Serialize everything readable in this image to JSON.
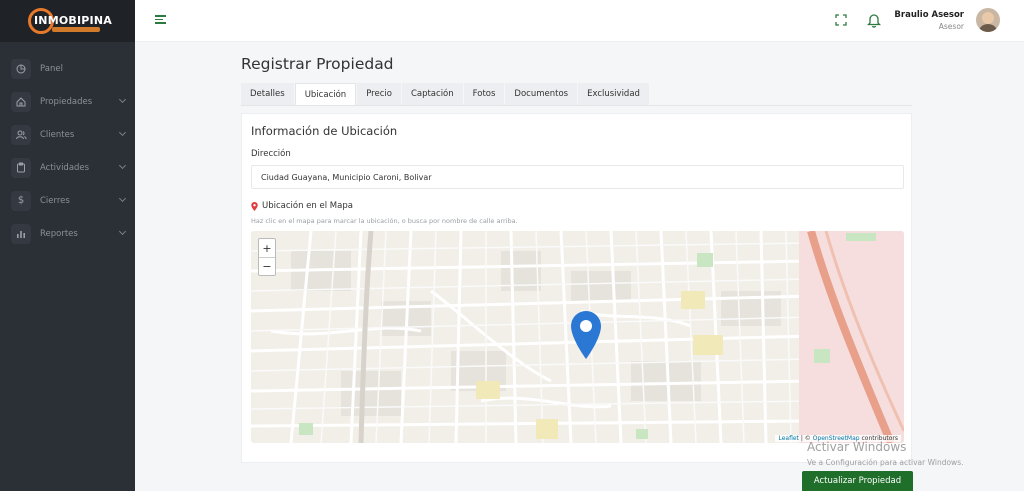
{
  "logo": {
    "text": "INMOBIPINA",
    "brand_color": "#e8782a"
  },
  "sidebar": {
    "items": [
      {
        "label": "Panel",
        "icon": "chart-pie-icon",
        "has_chevron": false
      },
      {
        "label": "Propiedades",
        "icon": "home-icon",
        "has_chevron": true
      },
      {
        "label": "Clientes",
        "icon": "users-icon",
        "has_chevron": true
      },
      {
        "label": "Actividades",
        "icon": "clipboard-icon",
        "has_chevron": true
      },
      {
        "label": "Cierres",
        "icon": "dollar-icon",
        "has_chevron": true
      },
      {
        "label": "Reportes",
        "icon": "bar-chart-icon",
        "has_chevron": true
      }
    ]
  },
  "header": {
    "menu_icon": "hamburger-icon",
    "fullscreen_icon": "expand-icon",
    "notification_icon": "bell-icon",
    "user_name": "Braulio Asesor",
    "user_role": "Asesor",
    "accent_color": "#2c7a3f"
  },
  "main": {
    "title": "Registrar Propiedad",
    "tabs": [
      {
        "label": "Detalles",
        "active": false
      },
      {
        "label": "Ubicación",
        "active": true
      },
      {
        "label": "Precio",
        "active": false
      },
      {
        "label": "Captación",
        "active": false
      },
      {
        "label": "Fotos",
        "active": false
      },
      {
        "label": "Documentos",
        "active": false
      },
      {
        "label": "Exclusividad",
        "active": false
      }
    ],
    "section_title": "Información de Ubicación",
    "address_label": "Dirección",
    "address_value": "Ciudad Guayana, Municipio Caroni, Bolivar",
    "map_label": "Ubicación en el Mapa",
    "map_hint": "Haz clic en el mapa para marcar la ubicación, o busca por nombre de calle arriba.",
    "map": {
      "zoom_in": "+",
      "zoom_out": "−",
      "attribution_leaflet": "Leaflet",
      "attribution_sep": " | © ",
      "attribution_osm": "OpenStreetMap",
      "attribution_rest": " contributors",
      "marker_color": "#2b78d4"
    },
    "submit_label": "Actualizar Propiedad"
  },
  "watermark": {
    "title": "Activar Windows",
    "subtitle": "Ve a Configuración para activar Windows."
  }
}
